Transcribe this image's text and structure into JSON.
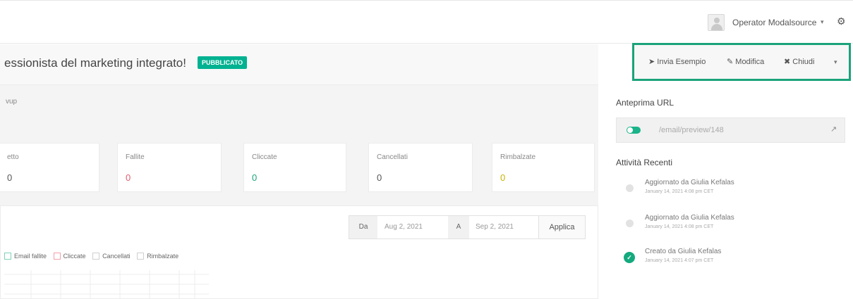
{
  "header": {
    "user_name": "Operator Modalsource",
    "user_caret": "▾",
    "gear_glyph": "⚙"
  },
  "main": {
    "title": "essionista del marketing integrato!",
    "status": "PUBBLICATO",
    "subtext": "vup",
    "stats": [
      {
        "label": "etto",
        "value": "0",
        "color": "#555555"
      },
      {
        "label": "Fallite",
        "value": "0",
        "color": "#e05d6f"
      },
      {
        "label": "Cliccate",
        "value": "0",
        "color": "#1aa37a"
      },
      {
        "label": "Cancellati",
        "value": "0",
        "color": "#555555"
      },
      {
        "label": "Rimbalzate",
        "value": "0",
        "color": "#c9b300"
      }
    ]
  },
  "date_filter": {
    "from_label": "Da",
    "from_value": "Aug 2, 2021",
    "to_label": "A",
    "to_value": "Sep 2, 2021",
    "apply_label": "Applica"
  },
  "legend": [
    {
      "label": "Email fallite",
      "color": "#7fd1b9"
    },
    {
      "label": "Cliccate",
      "color": "#f2a0ab"
    },
    {
      "label": "Cancellati",
      "color": "#cfcfcf"
    },
    {
      "label": "Rimbalzate",
      "color": "#cfcfcf"
    }
  ],
  "actions": {
    "send_label": "Invia Esempio",
    "edit_label": "Modifica",
    "close_label": "Chiudi",
    "caret": "▾"
  },
  "preview": {
    "title": "Anteprima URL",
    "url": "/email/preview/148"
  },
  "activity": {
    "title": "Attività Recenti",
    "items": [
      {
        "text": "Aggiornato da Giulia Kefalas",
        "date": "January 14, 2021 4:08 pm CET"
      },
      {
        "text": "Aggiornato da Giulia Kefalas",
        "date": "January 14, 2021 4:08 pm CET"
      },
      {
        "text": "Creato da Giulia Kefalas",
        "date": "January 14, 2021 4:07 pm CET"
      }
    ]
  },
  "colors": {
    "accent": "#00b291",
    "highlight_border": "#1aa37a"
  }
}
